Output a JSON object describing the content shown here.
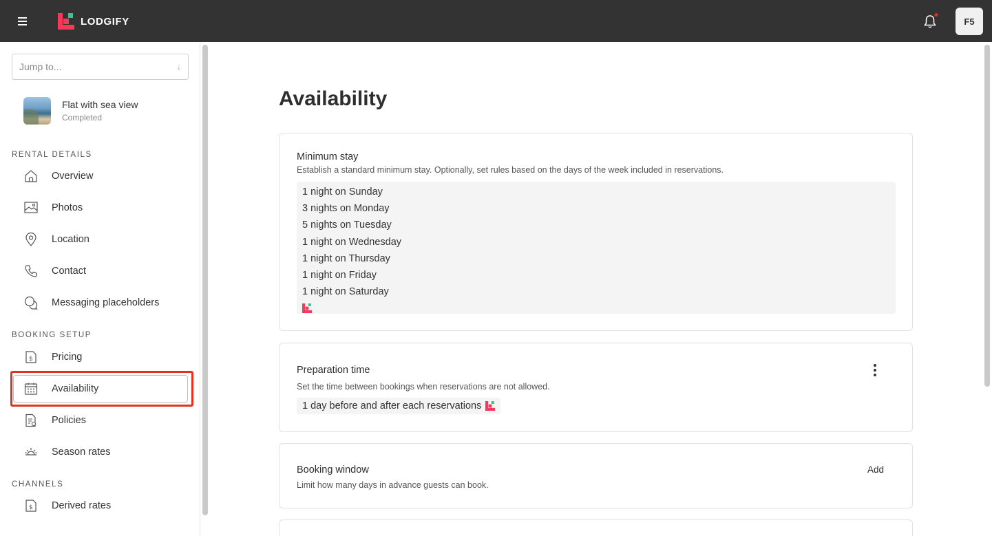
{
  "topbar": {
    "logo_text": "LODGIFY",
    "avatar_initials": "F5",
    "notification_dot_color": "#e5301e"
  },
  "sidebar": {
    "jump_placeholder": "Jump to...",
    "property": {
      "name": "Flat with sea view",
      "status": "Completed"
    },
    "sections": [
      {
        "label": "RENTAL DETAILS",
        "items": [
          {
            "label": "Overview",
            "icon": "home-icon"
          },
          {
            "label": "Photos",
            "icon": "image-icon"
          },
          {
            "label": "Location",
            "icon": "pin-icon"
          },
          {
            "label": "Contact",
            "icon": "phone-icon"
          },
          {
            "label": "Messaging placeholders",
            "icon": "chat-icon"
          }
        ]
      },
      {
        "label": "BOOKING SETUP",
        "items": [
          {
            "label": "Pricing",
            "icon": "price-tag-icon"
          },
          {
            "label": "Availability",
            "icon": "calendar-icon",
            "active": true
          },
          {
            "label": "Policies",
            "icon": "document-icon"
          },
          {
            "label": "Season rates",
            "icon": "sun-icon"
          }
        ]
      },
      {
        "label": "CHANNELS",
        "items": [
          {
            "label": "Derived rates",
            "icon": "price-tag-icon"
          }
        ]
      }
    ]
  },
  "main": {
    "title": "Availability",
    "minimum_stay": {
      "title": "Minimum stay",
      "description": "Establish a standard minimum stay. Optionally, set rules based on the days of the week included in reservations.",
      "rules": [
        "1 night on Sunday",
        "3 nights on Monday",
        "5 nights on Tuesday",
        "1 night on Wednesday",
        "1 night on Thursday",
        "1 night on Friday",
        "1 night on Saturday"
      ]
    },
    "preparation_time": {
      "title": "Preparation time",
      "description": "Set the time between bookings when reservations are not allowed.",
      "value": "1 day before and after each reservations"
    },
    "booking_window": {
      "title": "Booking window",
      "description": "Limit how many days in advance guests can book.",
      "action_label": "Add"
    }
  },
  "colors": {
    "accent": "#f23a5a",
    "accent_secondary": "#2ecc8b",
    "topbar": "#333333",
    "highlight": "#e5301e"
  }
}
